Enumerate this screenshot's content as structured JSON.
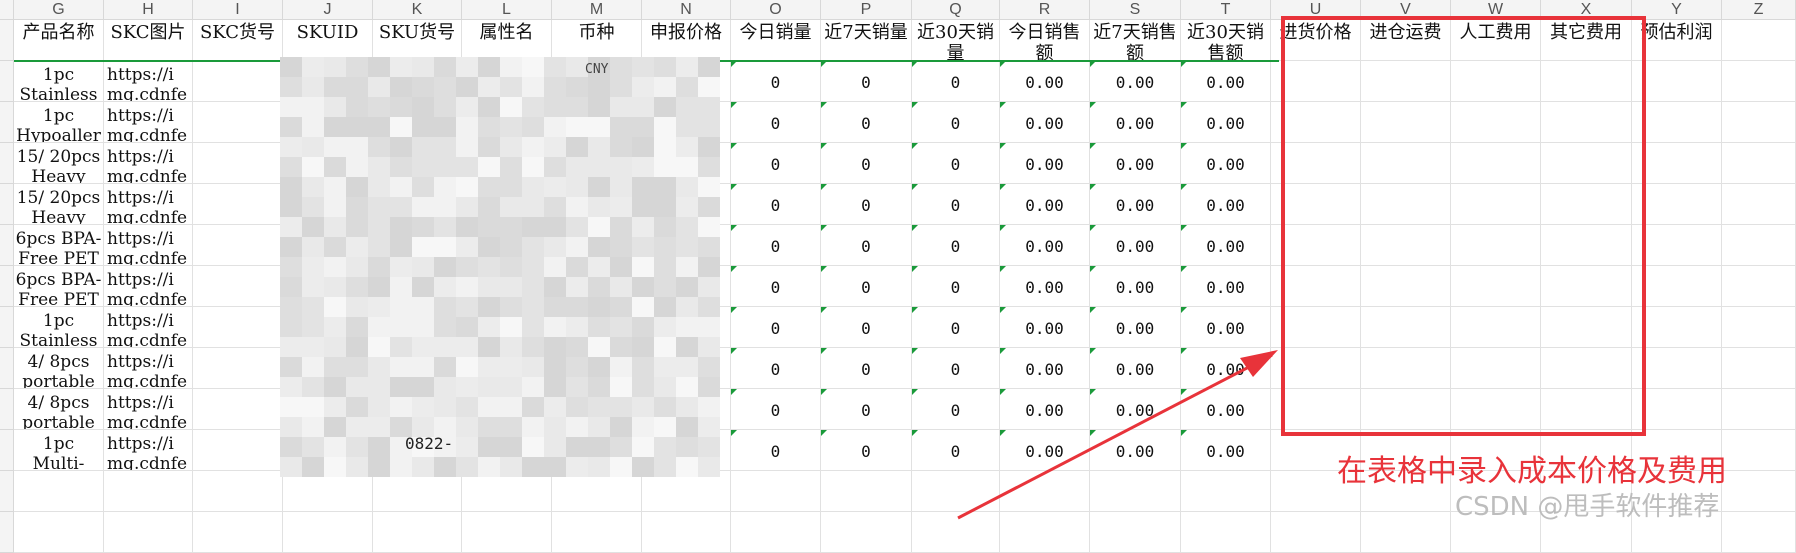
{
  "columns": [
    {
      "letter": "G",
      "header": "产品名称"
    },
    {
      "letter": "H",
      "header": "SKC图片"
    },
    {
      "letter": "I",
      "header": "SKC货号"
    },
    {
      "letter": "J",
      "header": "SKUID"
    },
    {
      "letter": "K",
      "header": "SKU货号"
    },
    {
      "letter": "L",
      "header": "属性名"
    },
    {
      "letter": "M",
      "header": "币种"
    },
    {
      "letter": "N",
      "header": "申报价格"
    },
    {
      "letter": "O",
      "header": "今日销量"
    },
    {
      "letter": "P",
      "header": "近7天销量"
    },
    {
      "letter": "Q",
      "header": "近30天销量"
    },
    {
      "letter": "R",
      "header": "今日销售额"
    },
    {
      "letter": "S",
      "header": "近7天销售额"
    },
    {
      "letter": "T",
      "header": "近30天销售额"
    },
    {
      "letter": "U",
      "header": "进货价格"
    },
    {
      "letter": "V",
      "header": "进仓运费"
    },
    {
      "letter": "W",
      "header": "人工费用"
    },
    {
      "letter": "X",
      "header": "其它费用"
    },
    {
      "letter": "Y",
      "header": "预估利润"
    },
    {
      "letter": "Z",
      "header": ""
    }
  ],
  "rows": [
    {
      "name": [
        "1pc",
        "Stainless"
      ],
      "img": [
        "https://i",
        "mg.cdnfe"
      ],
      "o": "0",
      "p": "0",
      "q": "0",
      "r": "0.00",
      "s": "0.00",
      "t": "0.00"
    },
    {
      "name": [
        "1pc",
        "Hypoaller"
      ],
      "img": [
        "https://i",
        "mg.cdnfe"
      ],
      "o": "0",
      "p": "0",
      "q": "0",
      "r": "0.00",
      "s": "0.00",
      "t": "0.00"
    },
    {
      "name": [
        "15/ 20pcs",
        "Heavy"
      ],
      "img": [
        "https://i",
        "mg.cdnfe"
      ],
      "o": "0",
      "p": "0",
      "q": "0",
      "r": "0.00",
      "s": "0.00",
      "t": "0.00"
    },
    {
      "name": [
        "15/ 20pcs",
        "Heavy"
      ],
      "img": [
        "https://i",
        "mg.cdnfe"
      ],
      "o": "0",
      "p": "0",
      "q": "0",
      "r": "0.00",
      "s": "0.00",
      "t": "0.00"
    },
    {
      "name": [
        "6pcs BPA-",
        "Free PET"
      ],
      "img": [
        "https://i",
        "mg.cdnfe"
      ],
      "o": "0",
      "p": "0",
      "q": "0",
      "r": "0.00",
      "s": "0.00",
      "t": "0.00"
    },
    {
      "name": [
        "6pcs BPA-",
        "Free PET"
      ],
      "img": [
        "https://i",
        "mg.cdnfe"
      ],
      "o": "0",
      "p": "0",
      "q": "0",
      "r": "0.00",
      "s": "0.00",
      "t": "0.00"
    },
    {
      "name": [
        "1pc",
        "Stainless"
      ],
      "img": [
        "https://i",
        "mg.cdnfe"
      ],
      "o": "0",
      "p": "0",
      "q": "0",
      "r": "0.00",
      "s": "0.00",
      "t": "0.00"
    },
    {
      "name": [
        "4/ 8pcs",
        "portable"
      ],
      "img": [
        "https://i",
        "mg.cdnfe"
      ],
      "o": "0",
      "p": "0",
      "q": "0",
      "r": "0.00",
      "s": "0.00",
      "t": "0.00"
    },
    {
      "name": [
        "4/ 8pcs",
        "portable"
      ],
      "img": [
        "https://i",
        "mg.cdnfe"
      ],
      "o": "0",
      "p": "0",
      "q": "0",
      "r": "0.00",
      "s": "0.00",
      "t": "0.00"
    },
    {
      "name": [
        "1pc",
        "Multi-"
      ],
      "img": [
        "https://i",
        "mg.cdnfe"
      ],
      "o": "0",
      "p": "0",
      "q": "0",
      "r": "0.00",
      "s": "0.00",
      "t": "0.00"
    }
  ],
  "partial_fragments": {
    "m_row1": "CNY",
    "k_row10": "0822-"
  },
  "annotation_text": "在表格中录入成本价格及费用",
  "watermark": "CSDN @甩手软件推荐",
  "colors": {
    "accent_red": "#e8333a",
    "green_marker": "#1a9a3a"
  }
}
